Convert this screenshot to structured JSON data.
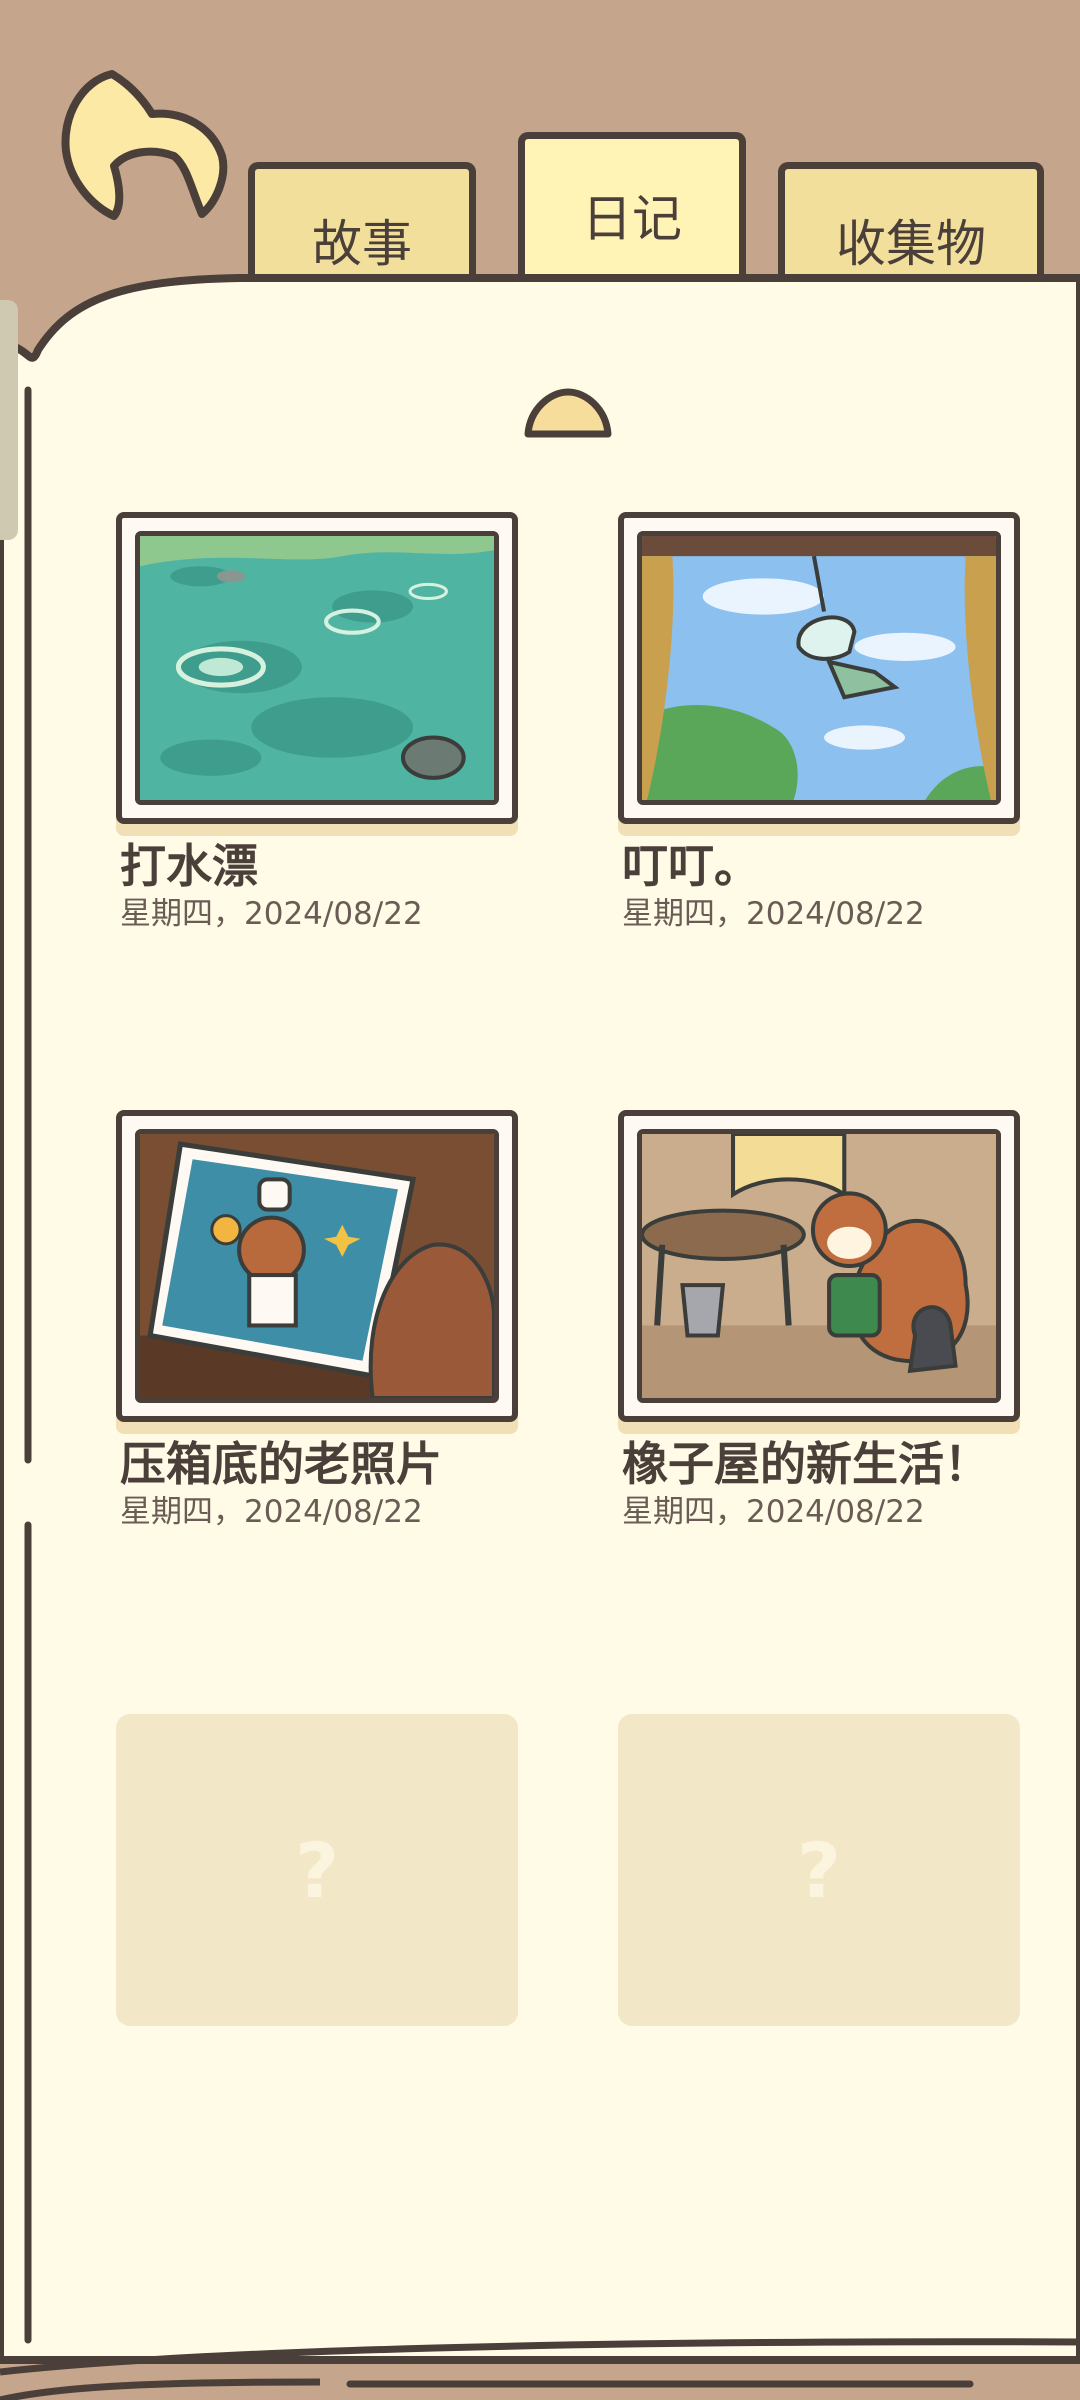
{
  "tabs": [
    {
      "label": "故事",
      "active": false
    },
    {
      "label": "日记",
      "active": true
    },
    {
      "label": "收集物",
      "active": false
    }
  ],
  "colors": {
    "background": "#c5a58c",
    "page": "#fffbe7",
    "outline": "#4b3f3a",
    "tab": "#f2df9b",
    "tab_active": "#fff3b6",
    "locked_card": "#f2e7c6"
  },
  "entries": [
    {
      "title": "打水漂",
      "date": "星期四，2024/08/22",
      "image": "pond-skipping-stones"
    },
    {
      "title": "叮叮。",
      "date": "星期四，2024/08/22",
      "image": "wind-chime-window"
    },
    {
      "title": "压箱底的老照片",
      "date": "星期四，2024/08/22",
      "image": "old-photo-squirrel"
    },
    {
      "title": "橡子屋的新生活！",
      "date": "星期四，2024/08/22",
      "image": "acorn-house-cleaning"
    }
  ],
  "locked": [
    {
      "label": "?"
    },
    {
      "label": "?"
    }
  ]
}
